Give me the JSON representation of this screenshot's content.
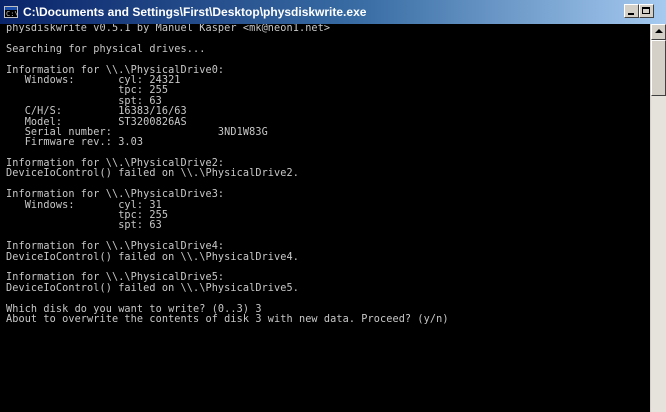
{
  "window": {
    "title": "C:\\Documents and Settings\\First\\Desktop\\physdiskwrite.exe",
    "icon": "console-icon",
    "buttons": {
      "minimize": "_",
      "maximize": "□",
      "close": ""
    }
  },
  "console": {
    "lines": [
      "physdiskwrite v0.5.1 by Manuel Kasper <mk@neon1.net>",
      "",
      "Searching for physical drives...",
      "",
      "Information for \\\\.\\PhysicalDrive0:",
      "   Windows:       cyl: 24321",
      "                  tpc: 255",
      "                  spt: 63",
      "   C/H/S:         16383/16/63",
      "   Model:         ST3200826AS",
      "   Serial number:                 3ND1W83G",
      "   Firmware rev.: 3.03",
      "",
      "Information for \\\\.\\PhysicalDrive2:",
      "DeviceIoControl() failed on \\\\.\\PhysicalDrive2.",
      "",
      "Information for \\\\.\\PhysicalDrive3:",
      "   Windows:       cyl: 31",
      "                  tpc: 255",
      "                  spt: 63",
      "",
      "Information for \\\\.\\PhysicalDrive4:",
      "DeviceIoControl() failed on \\\\.\\PhysicalDrive4.",
      "",
      "Information for \\\\.\\PhysicalDrive5:",
      "DeviceIoControl() failed on \\\\.\\PhysicalDrive5.",
      "",
      "Which disk do you want to write? (0..3) 3",
      "About to overwrite the contents of disk 3 with new data. Proceed? (y/n)"
    ]
  },
  "colors": {
    "console_background": "#000000",
    "console_text": "#c8c8c8",
    "titlebar_start": "#0a246a",
    "titlebar_end": "#a6caf0"
  }
}
